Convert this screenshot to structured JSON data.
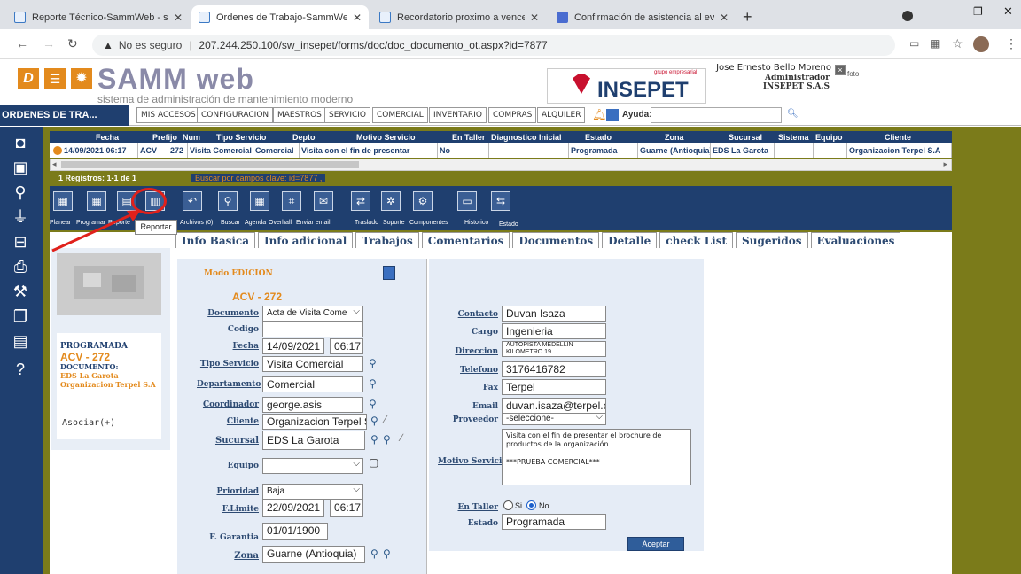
{
  "browser": {
    "tabs": [
      {
        "label": "Reporte Técnico-SammWeb - sist",
        "active": false
      },
      {
        "label": "Ordenes de Trabajo-SammWeb -",
        "active": true
      },
      {
        "label": "Recordatorio proximo a vencer",
        "active": false
      },
      {
        "label": "Confirmación de asistencia al eve",
        "active": false
      }
    ],
    "insecure_label": "No es seguro",
    "url": "207.244.250.100/sw_insepet/forms/doc/doc_documento_ot.aspx?id=7877"
  },
  "app": {
    "logo_text": "SAMM web",
    "logo_subtitle": "sistema de administración de mantenimiento moderno",
    "brand_grupo": "grupo empresarial",
    "brand_name": "INSEPET",
    "user_name": "Jose Ernesto Bello Moreno",
    "user_role": "Administrador",
    "user_company": "INSEPET S.A.S",
    "photo_alt": "foto",
    "section_title": "ORDENES DE TRA...",
    "menu": [
      "MIS ACCESOS",
      "CONFIGURACION",
      "MAESTROS",
      "SERVICIO",
      "COMERCIAL",
      "INVENTARIO",
      "COMPRAS",
      "ALQUILER"
    ],
    "help_label": "Ayuda:"
  },
  "grid": {
    "headers": [
      "Fecha",
      "Prefijo",
      "Num",
      "Tipo Servicio",
      "Depto",
      "Motivo Servicio",
      "En Taller",
      "Diagnostico Inicial",
      "Estado",
      "Zona",
      "Sucursal",
      "Sistema",
      "Equipo",
      "Cliente"
    ],
    "row": [
      "14/09/2021 06:17",
      "ACV",
      "272",
      "Visita Comercial",
      "Comercial",
      "Visita con el fin de presentar",
      "No",
      "",
      "Programada",
      "Guarne (Antioquia)",
      "EDS La Garota",
      "",
      "",
      "Organizacion Terpel S.A"
    ],
    "records_label": "1  Registros: 1-1 de  1",
    "search_info": "Buscar por campos clave: id=7877 ,"
  },
  "toolbar": {
    "labels": [
      "Planear",
      "Programar",
      "Reporte",
      "Reportar",
      "Archivos (0)",
      "Buscar",
      "Agenda",
      "Overhall",
      "Enviar email",
      "Traslado",
      "Soporte",
      "Componentes",
      "Historico",
      "Estado"
    ],
    "tooltip": "Reportar"
  },
  "tabs": [
    "Info Basica",
    "Info adicional",
    "Trabajos",
    "Comentarios",
    "Documentos",
    "Detalle",
    "check List",
    "Sugeridos",
    "Evaluaciones"
  ],
  "card": {
    "status": "PROGRAMADA",
    "code": "ACV - 272",
    "doc_label": "DOCUMENTO:",
    "site": "EDS La Garota",
    "client": "Organizacion Terpel S.A",
    "asociar": "Asociar(+)"
  },
  "form": {
    "mode": "Modo EDICION",
    "code": "ACV - 272",
    "documento_label": "Documento",
    "documento_value": "Acta de Visita Come",
    "codigo_label": "Codigo",
    "codigo_value": "",
    "fecha_label": "Fecha",
    "fecha_value": "14/09/2021",
    "hora_value": "06:17",
    "tipo_label": "Tipo Servicio",
    "tipo_value": "Visita Comercial",
    "depto_label": "Departamento",
    "depto_value": "Comercial",
    "coord_label": "Coordinador",
    "coord_value": "george.asis",
    "cliente_label": "Cliente",
    "cliente_value": "Organizacion Terpel S",
    "sucursal_label": "Sucursal",
    "sucursal_value": "EDS La Garota",
    "equipo_label": "Equipo",
    "equipo_value": "",
    "prioridad_label": "Prioridad",
    "prioridad_value": "Baja",
    "flimite_label": "F.Limite",
    "flimite_value": "22/09/2021",
    "flimite_hora": "06:17",
    "fgarantia_label": "F. Garantia",
    "fgarantia_value": "01/01/1900",
    "zona_label": "Zona",
    "zona_value": "Guarne (Antioquia)",
    "contacto_label": "Contacto",
    "contacto_value": "Duvan Isaza",
    "cargo_label": "Cargo",
    "cargo_value": "Ingenieria",
    "direccion_label": "Direccion",
    "direccion_value": "AUTOPISTA MEDELLIN KILOMETRO 19",
    "telefono_label": "Telefono",
    "telefono_value": "3176416782",
    "fax_label": "Fax",
    "fax_value": "Terpel",
    "email_label": "Email",
    "email_value": "duvan.isaza@terpel.c",
    "proveedor_label": "Proveedor",
    "proveedor_value": "-seleccione-",
    "motivo_label": "Motivo Servicio",
    "motivo_value": "Visita con el fin de presentar el brochure de productos de la organización\n\n***PRUEBA COMERCIAL***",
    "entaller_label": "En Taller",
    "si_label": "Si",
    "no_label": "No",
    "estado_label": "Estado",
    "estado_value": "Programada",
    "aceptar_label": "Aceptar"
  },
  "colors": {
    "navy": "#1f3f6f",
    "olive": "#7b7b1a",
    "orange": "#e38a1d",
    "red": "#e0211b"
  }
}
